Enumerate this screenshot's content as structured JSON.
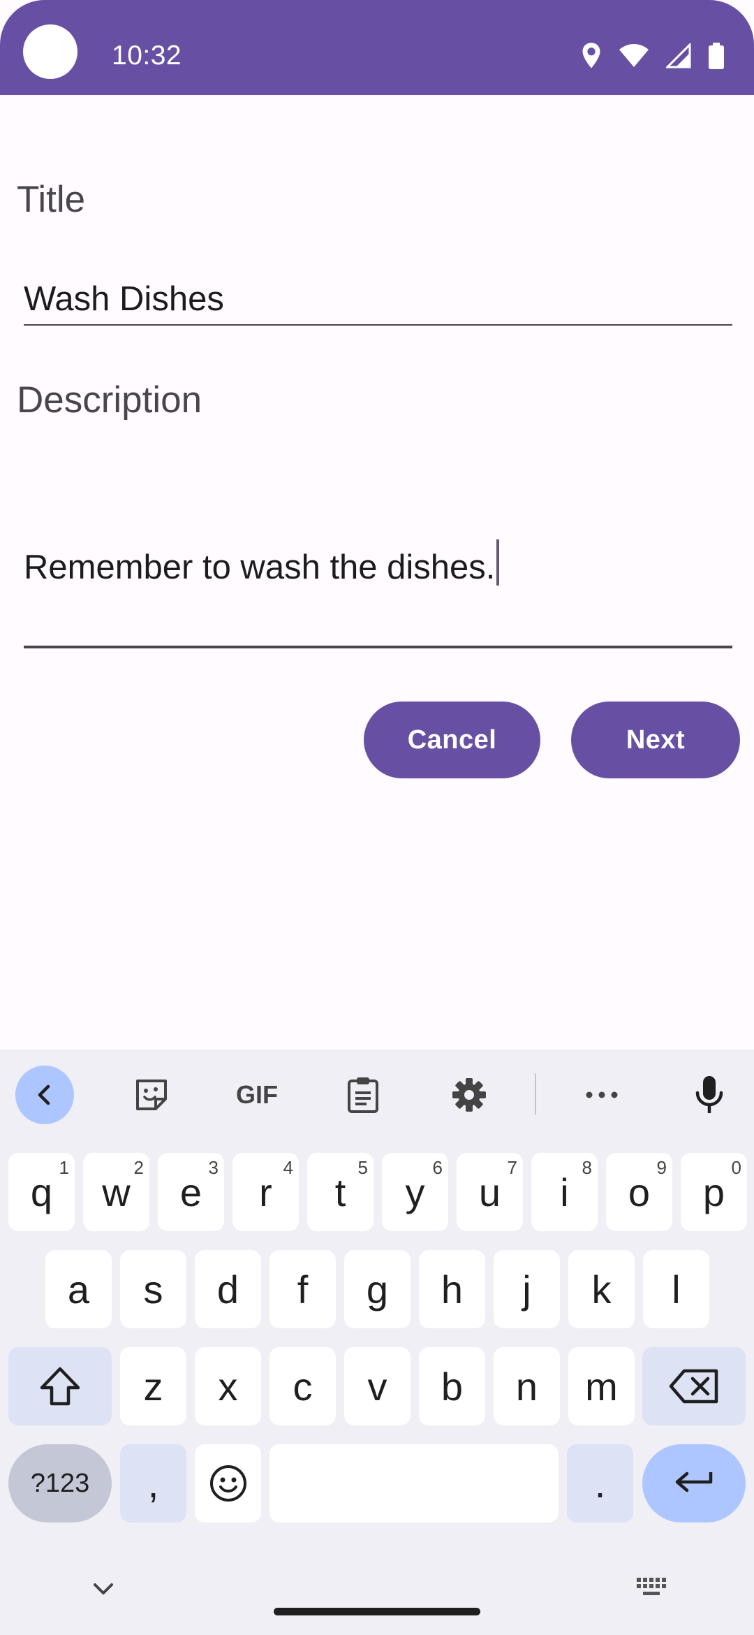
{
  "status_bar": {
    "time": "10:32"
  },
  "form": {
    "title_label": "Title",
    "title_value": "Wash Dishes",
    "description_label": "Description",
    "description_value": "Remember to wash the dishes."
  },
  "buttons": {
    "cancel": "Cancel",
    "next": "Next"
  },
  "keyboard": {
    "toolbar": {
      "gif": "GIF"
    },
    "row1": [
      {
        "key": "q",
        "hint": "1"
      },
      {
        "key": "w",
        "hint": "2"
      },
      {
        "key": "e",
        "hint": "3"
      },
      {
        "key": "r",
        "hint": "4"
      },
      {
        "key": "t",
        "hint": "5"
      },
      {
        "key": "y",
        "hint": "6"
      },
      {
        "key": "u",
        "hint": "7"
      },
      {
        "key": "i",
        "hint": "8"
      },
      {
        "key": "o",
        "hint": "9"
      },
      {
        "key": "p",
        "hint": "0"
      }
    ],
    "row2": [
      "a",
      "s",
      "d",
      "f",
      "g",
      "h",
      "j",
      "k",
      "l"
    ],
    "row3": [
      "z",
      "x",
      "c",
      "v",
      "b",
      "n",
      "m"
    ],
    "symbols_key": "?123",
    "comma_key": ",",
    "period_key": "."
  },
  "colors": {
    "primary": "#6750a4",
    "background": "#fffbfe",
    "keyboard_bg": "#f0eff5",
    "key_special": "#dde2f4",
    "key_accent": "#aec6ff"
  }
}
